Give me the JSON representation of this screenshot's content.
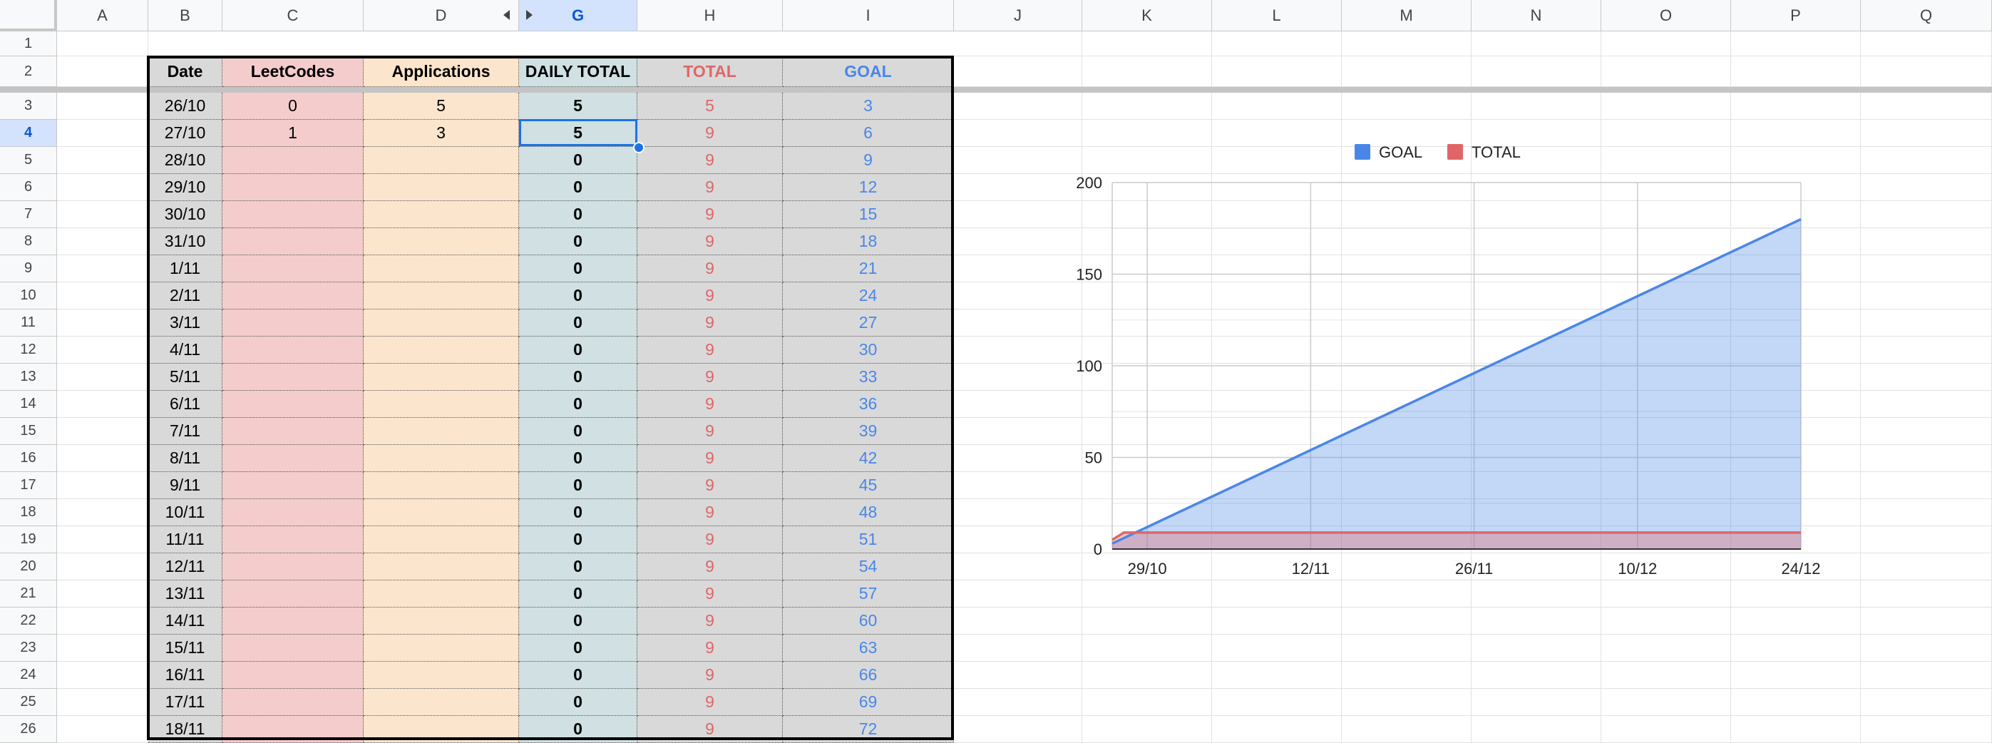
{
  "sheet": {
    "columns": [
      "A",
      "B",
      "C",
      "D",
      "G",
      "H",
      "I",
      "J",
      "K",
      "L",
      "M",
      "N",
      "O",
      "P",
      "Q"
    ],
    "selected_column": "G",
    "rows": [
      "1",
      "2",
      "3",
      "4",
      "5",
      "6",
      "7",
      "8",
      "9",
      "10",
      "11",
      "12",
      "13",
      "14",
      "15",
      "16",
      "17",
      "18",
      "19",
      "20",
      "21",
      "22",
      "23",
      "24",
      "25",
      "26"
    ],
    "selected_row": "4",
    "header_row": {
      "date": "Date",
      "leetcodes": "LeetCodes",
      "applications": "Applications",
      "daily_total": "DAILY TOTAL",
      "total": "TOTAL",
      "goal": "GOAL"
    },
    "data_rows": [
      {
        "date": "26/10",
        "leetcodes": "0",
        "applications": "5",
        "daily_total": "5",
        "total": "5",
        "goal": "3"
      },
      {
        "date": "27/10",
        "leetcodes": "1",
        "applications": "3",
        "daily_total": "5",
        "total": "9",
        "goal": "6"
      },
      {
        "date": "28/10",
        "leetcodes": "",
        "applications": "",
        "daily_total": "0",
        "total": "9",
        "goal": "9"
      },
      {
        "date": "29/10",
        "leetcodes": "",
        "applications": "",
        "daily_total": "0",
        "total": "9",
        "goal": "12"
      },
      {
        "date": "30/10",
        "leetcodes": "",
        "applications": "",
        "daily_total": "0",
        "total": "9",
        "goal": "15"
      },
      {
        "date": "31/10",
        "leetcodes": "",
        "applications": "",
        "daily_total": "0",
        "total": "9",
        "goal": "18"
      },
      {
        "date": "1/11",
        "leetcodes": "",
        "applications": "",
        "daily_total": "0",
        "total": "9",
        "goal": "21"
      },
      {
        "date": "2/11",
        "leetcodes": "",
        "applications": "",
        "daily_total": "0",
        "total": "9",
        "goal": "24"
      },
      {
        "date": "3/11",
        "leetcodes": "",
        "applications": "",
        "daily_total": "0",
        "total": "9",
        "goal": "27"
      },
      {
        "date": "4/11",
        "leetcodes": "",
        "applications": "",
        "daily_total": "0",
        "total": "9",
        "goal": "30"
      },
      {
        "date": "5/11",
        "leetcodes": "",
        "applications": "",
        "daily_total": "0",
        "total": "9",
        "goal": "33"
      },
      {
        "date": "6/11",
        "leetcodes": "",
        "applications": "",
        "daily_total": "0",
        "total": "9",
        "goal": "36"
      },
      {
        "date": "7/11",
        "leetcodes": "",
        "applications": "",
        "daily_total": "0",
        "total": "9",
        "goal": "39"
      },
      {
        "date": "8/11",
        "leetcodes": "",
        "applications": "",
        "daily_total": "0",
        "total": "9",
        "goal": "42"
      },
      {
        "date": "9/11",
        "leetcodes": "",
        "applications": "",
        "daily_total": "0",
        "total": "9",
        "goal": "45"
      },
      {
        "date": "10/11",
        "leetcodes": "",
        "applications": "",
        "daily_total": "0",
        "total": "9",
        "goal": "48"
      },
      {
        "date": "11/11",
        "leetcodes": "",
        "applications": "",
        "daily_total": "0",
        "total": "9",
        "goal": "51"
      },
      {
        "date": "12/11",
        "leetcodes": "",
        "applications": "",
        "daily_total": "0",
        "total": "9",
        "goal": "54"
      },
      {
        "date": "13/11",
        "leetcodes": "",
        "applications": "",
        "daily_total": "0",
        "total": "9",
        "goal": "57"
      },
      {
        "date": "14/11",
        "leetcodes": "",
        "applications": "",
        "daily_total": "0",
        "total": "9",
        "goal": "60"
      },
      {
        "date": "15/11",
        "leetcodes": "",
        "applications": "",
        "daily_total": "0",
        "total": "9",
        "goal": "63"
      },
      {
        "date": "16/11",
        "leetcodes": "",
        "applications": "",
        "daily_total": "0",
        "total": "9",
        "goal": "66"
      },
      {
        "date": "17/11",
        "leetcodes": "",
        "applications": "",
        "daily_total": "0",
        "total": "9",
        "goal": "69"
      },
      {
        "date": "18/11",
        "leetcodes": "",
        "applications": "",
        "daily_total": "0",
        "total": "9",
        "goal": "72"
      }
    ],
    "colors": {
      "leetcodes_fill": "#f4cccc",
      "applications_fill": "#fce5cd",
      "daily_total_fill": "#d0e0e3",
      "gray_fill": "#d9d9d9",
      "total_text": "#e06666",
      "goal_text": "#4a86e8",
      "selection": "#1a73e8"
    }
  },
  "chart_data": {
    "type": "area",
    "x_ticks": [
      "29/10",
      "12/11",
      "26/11",
      "10/12",
      "24/12"
    ],
    "ylim": [
      0,
      200
    ],
    "y_ticks": [
      "0",
      "50",
      "100",
      "150",
      "200"
    ],
    "legend_position": "top",
    "series": [
      {
        "name": "GOAL",
        "color": "#4a86e8",
        "x": [
          "26/10",
          "24/12"
        ],
        "values": [
          3,
          180
        ]
      },
      {
        "name": "TOTAL",
        "color": "#e06666",
        "x": [
          "26/10",
          "27/10",
          "24/12"
        ],
        "values": [
          5,
          9,
          9
        ]
      }
    ]
  }
}
